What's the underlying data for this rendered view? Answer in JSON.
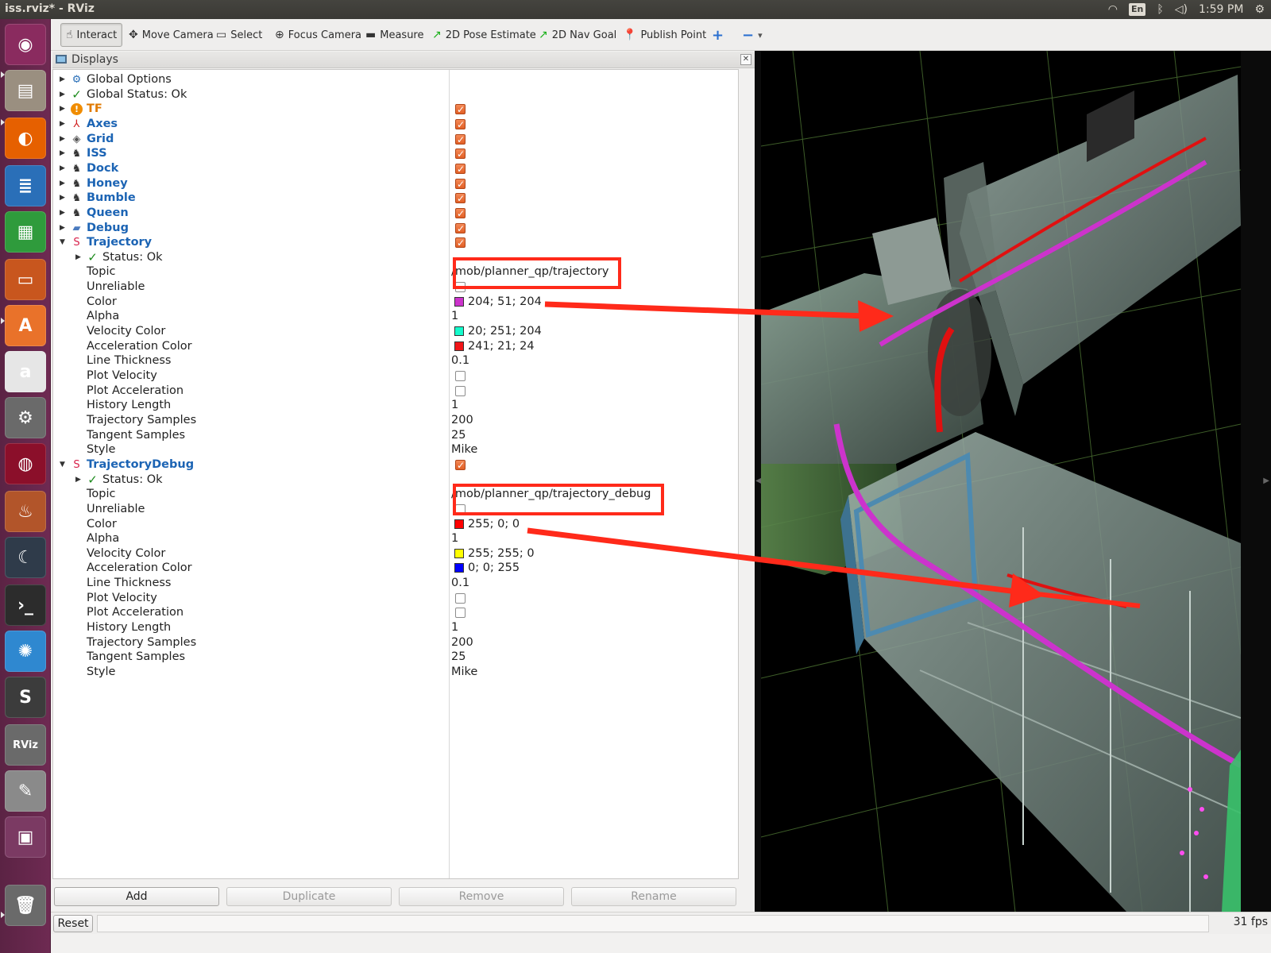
{
  "window": {
    "title": "iss.rviz* - RViz"
  },
  "indicators": {
    "lang": "En",
    "time": "1:59 PM"
  },
  "launcher": {
    "items": [
      {
        "name": "ubuntu-dash-icon",
        "color": "#8a2b5f",
        "glyph": "◉"
      },
      {
        "name": "files-icon",
        "color": "#9a8f80",
        "glyph": "▤"
      },
      {
        "name": "firefox-icon",
        "color": "#e66000",
        "glyph": "◐"
      },
      {
        "name": "writer-icon",
        "color": "#2a6fb8",
        "glyph": "≣"
      },
      {
        "name": "calc-icon",
        "color": "#2f9b3c",
        "glyph": "▦"
      },
      {
        "name": "impress-icon",
        "color": "#c8561e",
        "glyph": "▭"
      },
      {
        "name": "software-center-icon",
        "color": "#e9722a",
        "glyph": "A"
      },
      {
        "name": "amazon-icon",
        "color": "#e6e6e6",
        "glyph": "a"
      },
      {
        "name": "system-settings-icon",
        "color": "#6a6a6a",
        "glyph": "⚙"
      },
      {
        "name": "ruby-icon",
        "color": "#8b0f2a",
        "glyph": "◍"
      },
      {
        "name": "wine-icon",
        "color": "#b2552a",
        "glyph": "♨"
      },
      {
        "name": "screensaver-icon",
        "color": "#2f3b4a",
        "glyph": "☾"
      },
      {
        "name": "terminal-icon",
        "color": "#2c2c2c",
        "glyph": "›_"
      },
      {
        "name": "network-icon",
        "color": "#2f88d0",
        "glyph": "✺"
      },
      {
        "name": "sublime-icon",
        "color": "#3c3c3c",
        "glyph": "S"
      },
      {
        "name": "rviz-icon",
        "color": "#6a6a6a",
        "glyph": "RViz"
      },
      {
        "name": "text-editor-icon",
        "color": "#8a8a8a",
        "glyph": "✎"
      },
      {
        "name": "workspace-switcher-icon",
        "color": "#7b3a63",
        "glyph": "▣"
      },
      {
        "name": "trash-icon",
        "color": "#6a6a6a",
        "glyph": "🗑"
      }
    ]
  },
  "toolbar": {
    "tools": [
      {
        "name": "interact-tool",
        "label": "Interact",
        "icon": "☝",
        "iconColor": "#333",
        "active": true
      },
      {
        "name": "move-camera-tool",
        "label": "Move Camera",
        "icon": "✥",
        "iconColor": "#333",
        "active": false
      },
      {
        "name": "select-tool",
        "label": "Select",
        "icon": "▭",
        "iconColor": "#333",
        "active": false
      },
      {
        "name": "focus-camera-tool",
        "label": "Focus Camera",
        "icon": "⊕",
        "iconColor": "#333",
        "active": false
      },
      {
        "name": "measure-tool",
        "label": "Measure",
        "icon": "▬",
        "iconColor": "#333",
        "active": false
      },
      {
        "name": "2d-pose-estimate-tool",
        "label": "2D Pose Estimate",
        "icon": "↗",
        "iconColor": "#18b018",
        "active": false
      },
      {
        "name": "2d-nav-goal-tool",
        "label": "2D Nav Goal",
        "icon": "↗",
        "iconColor": "#18b018",
        "active": false
      },
      {
        "name": "publish-point-tool",
        "label": "Publish Point",
        "icon": "📍",
        "iconColor": "#d02020",
        "active": false
      }
    ],
    "add_glyph": "+",
    "remove_glyph": "−"
  },
  "displays": {
    "title": "Displays",
    "rows": [
      {
        "label": "Global Options",
        "style": "plain",
        "arrow": "▶",
        "indent": 0,
        "icon": "⚙",
        "iconColor": "#2a6fb8"
      },
      {
        "label": "Global Status: Ok",
        "style": "plain",
        "arrow": "▶",
        "indent": 0,
        "icon": "✓",
        "iconColor": "#1c8a1c"
      },
      {
        "label": "TF",
        "style": "bold-orange",
        "arrow": "▶",
        "indent": 0,
        "icon": "!",
        "iconColor": "#f08c00",
        "check": true
      },
      {
        "label": "Axes",
        "style": "bold-blue",
        "arrow": "▶",
        "indent": 0,
        "icon": "⅄",
        "iconColor": "#d02020",
        "check": true
      },
      {
        "label": "Grid",
        "style": "bold-blue",
        "arrow": "▶",
        "indent": 0,
        "icon": "◈",
        "iconColor": "#555",
        "check": true
      },
      {
        "label": "ISS",
        "style": "bold-blue",
        "arrow": "▶",
        "indent": 0,
        "icon": "♞",
        "iconColor": "#333",
        "check": true
      },
      {
        "label": "Dock",
        "style": "bold-blue",
        "arrow": "▶",
        "indent": 0,
        "icon": "♞",
        "iconColor": "#333",
        "check": true
      },
      {
        "label": "Honey",
        "style": "bold-blue",
        "arrow": "▶",
        "indent": 0,
        "icon": "♞",
        "iconColor": "#333",
        "check": true
      },
      {
        "label": "Bumble",
        "style": "bold-blue",
        "arrow": "▶",
        "indent": 0,
        "icon": "♞",
        "iconColor": "#333",
        "check": true
      },
      {
        "label": "Queen",
        "style": "bold-blue",
        "arrow": "▶",
        "indent": 0,
        "icon": "♞",
        "iconColor": "#333",
        "check": true
      },
      {
        "label": "Debug",
        "style": "bold-blue",
        "arrow": "▶",
        "indent": 0,
        "icon": "▰",
        "iconColor": "#4a7bbf",
        "check": true
      },
      {
        "label": "Trajectory",
        "style": "bold-blue",
        "arrow": "▼",
        "indent": 0,
        "icon": "S",
        "iconColor": "#d8204a",
        "check": true
      },
      {
        "label": "Status: Ok",
        "style": "plain",
        "arrow": "▶",
        "indent": 1,
        "icon": "✓",
        "iconColor": "#1c8a1c"
      },
      {
        "label": "Topic",
        "style": "plain",
        "indent": 2,
        "value": "/mob/planner_qp/trajectory"
      },
      {
        "label": "Unreliable",
        "style": "plain",
        "indent": 2,
        "check": false
      },
      {
        "label": "Color",
        "style": "plain",
        "indent": 2,
        "swatch": "#cc33cc",
        "value": "204; 51; 204"
      },
      {
        "label": "Alpha",
        "style": "plain",
        "indent": 2,
        "value": "1"
      },
      {
        "label": "Velocity Color",
        "style": "plain",
        "indent": 2,
        "swatch": "#14fbcc",
        "value": "20; 251; 204"
      },
      {
        "label": "Acceleration Color",
        "style": "plain",
        "indent": 2,
        "swatch": "#f11518",
        "value": "241; 21; 24"
      },
      {
        "label": "Line Thickness",
        "style": "plain",
        "indent": 2,
        "value": "0.1"
      },
      {
        "label": "Plot Velocity",
        "style": "plain",
        "indent": 2,
        "check": false
      },
      {
        "label": "Plot Acceleration",
        "style": "plain",
        "indent": 2,
        "check": false
      },
      {
        "label": "History Length",
        "style": "plain",
        "indent": 2,
        "value": "1"
      },
      {
        "label": "Trajectory Samples",
        "style": "plain",
        "indent": 2,
        "value": "200"
      },
      {
        "label": "Tangent Samples",
        "style": "plain",
        "indent": 2,
        "value": "25"
      },
      {
        "label": "Style",
        "style": "plain",
        "indent": 2,
        "value": "Mike"
      },
      {
        "label": "TrajectoryDebug",
        "style": "bold-blue",
        "arrow": "▼",
        "indent": 0,
        "icon": "S",
        "iconColor": "#d8204a",
        "check": true
      },
      {
        "label": "Status: Ok",
        "style": "plain",
        "arrow": "▶",
        "indent": 1,
        "icon": "✓",
        "iconColor": "#1c8a1c"
      },
      {
        "label": "Topic",
        "style": "plain",
        "indent": 2,
        "value": "/mob/planner_qp/trajectory_debug"
      },
      {
        "label": "Unreliable",
        "style": "plain",
        "indent": 2,
        "check": false
      },
      {
        "label": "Color",
        "style": "plain",
        "indent": 2,
        "swatch": "#ff0000",
        "value": "255; 0; 0"
      },
      {
        "label": "Alpha",
        "style": "plain",
        "indent": 2,
        "value": "1"
      },
      {
        "label": "Velocity Color",
        "style": "plain",
        "indent": 2,
        "swatch": "#ffff00",
        "value": "255; 255; 0"
      },
      {
        "label": "Acceleration Color",
        "style": "plain",
        "indent": 2,
        "swatch": "#0000ff",
        "value": "0; 0; 255"
      },
      {
        "label": "Line Thickness",
        "style": "plain",
        "indent": 2,
        "value": "0.1"
      },
      {
        "label": "Plot Velocity",
        "style": "plain",
        "indent": 2,
        "check": false
      },
      {
        "label": "Plot Acceleration",
        "style": "plain",
        "indent": 2,
        "check": false
      },
      {
        "label": "History Length",
        "style": "plain",
        "indent": 2,
        "value": "1"
      },
      {
        "label": "Trajectory Samples",
        "style": "plain",
        "indent": 2,
        "value": "200"
      },
      {
        "label": "Tangent Samples",
        "style": "plain",
        "indent": 2,
        "value": "25"
      },
      {
        "label": "Style",
        "style": "plain",
        "indent": 2,
        "value": "Mike"
      }
    ]
  },
  "buttons": {
    "add": "Add",
    "duplicate": "Duplicate",
    "remove": "Remove",
    "rename": "Rename"
  },
  "statusbar": {
    "reset": "Reset",
    "fps": "31 fps"
  },
  "colors": {
    "annotation": "#ff2a1a",
    "trajectory_purple": "#cc33cc",
    "debug_red": "#ff0000"
  }
}
